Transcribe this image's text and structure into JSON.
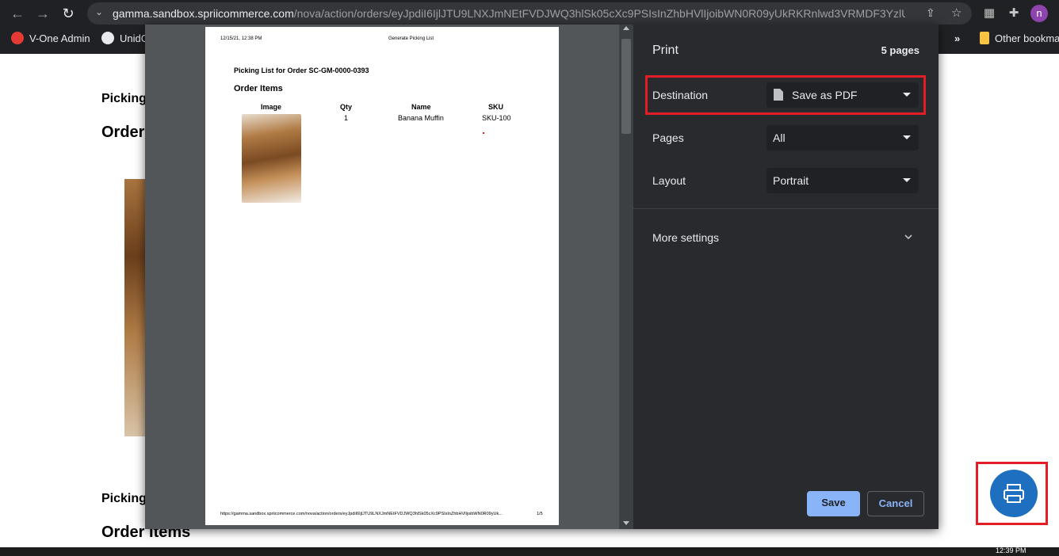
{
  "browser": {
    "url_host": "gamma.sandbox.spriicommerce.com",
    "url_path": "/nova/action/orders/eyJpdiI6IjlJTU9LNXJmNEtFVDJWQ3hlSk05cXc9PSIsInZhbHVlIjoibWN0R09yUkRKRnlwd3VRMDF3YzlUXC9S...",
    "avatar_letter": "n",
    "bookmarks": [
      "V-One Admin",
      "UnidC"
    ],
    "bookmarks_overflow": "»",
    "other_bookmarks": "Other bookma"
  },
  "page": {
    "heading_picking_top": "Picking",
    "heading_order_top": "Order",
    "heading_picking_bottom": "Picking",
    "heading_order_items_bottom": "Order Items"
  },
  "preview": {
    "header_date": "12/15/21, 12:38 PM",
    "header_title": "Generate Picking List",
    "doc_title": "Picking List for Order SC-GM-0000-0393",
    "section_title": "Order Items",
    "columns": [
      "Image",
      "Qty",
      "Name",
      "SKU"
    ],
    "row": {
      "qty": "1",
      "name": "Banana Muffin",
      "sku": "SKU-100"
    },
    "footer_url": "https://gamma.sandbox.spriicommerce.com/nova/action/orders/eyJpdiI6IjlJTU9LNXJmNEtFVDJWQ3hlSk05cXc9PSIsInZhbHVlIjoibWN0R09yUk...",
    "footer_page": "1/5"
  },
  "print": {
    "title": "Print",
    "pages_count": "5 pages",
    "destination_label": "Destination",
    "destination_value": "Save as PDF",
    "pages_label": "Pages",
    "pages_value": "All",
    "layout_label": "Layout",
    "layout_value": "Portrait",
    "more_settings": "More settings",
    "save_button": "Save",
    "cancel_button": "Cancel"
  },
  "taskbar": {
    "time": "12:39 PM"
  },
  "colors": {
    "highlight": "#e21d25",
    "fab": "#1e6fbf",
    "save_button": "#8ab4f8",
    "cancel_text": "#8ab4f8"
  },
  "icons": [
    "back-arrow-icon",
    "forward-arrow-icon",
    "reload-icon",
    "site-info-icon",
    "share-icon",
    "star-icon",
    "extension-icon",
    "puzzle-icon",
    "document-icon",
    "chevron-down-icon",
    "printer-icon"
  ]
}
